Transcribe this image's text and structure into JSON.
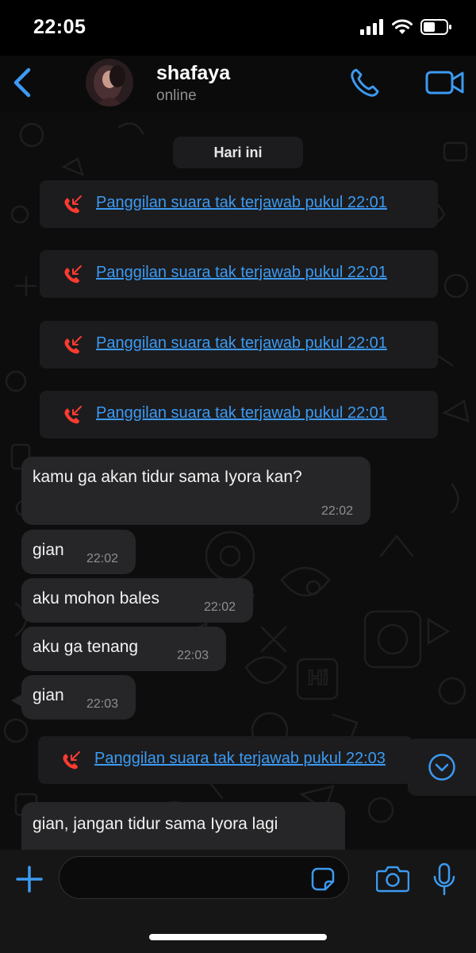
{
  "status_bar": {
    "time": "22:05"
  },
  "header": {
    "contact_name": "shafaya",
    "presence": "online"
  },
  "chat": {
    "date_label": "Hari ini",
    "missed_calls": [
      {
        "text": "Panggilan suara tak terjawab pukul 22:01"
      },
      {
        "text": "Panggilan suara tak terjawab pukul 22:01"
      },
      {
        "text": "Panggilan suara tak terjawab pukul 22:01"
      },
      {
        "text": "Panggilan suara tak terjawab pukul 22:01"
      }
    ],
    "messages": [
      {
        "text": "kamu ga akan tidur sama Iyora kan?",
        "time": "22:02"
      },
      {
        "text": "gian",
        "time": "22:02"
      },
      {
        "text": "aku mohon bales",
        "time": "22:02"
      },
      {
        "text": "aku ga tenang",
        "time": "22:03"
      },
      {
        "text": "gian",
        "time": "22:03"
      }
    ],
    "missed_call_later": {
      "text": "Panggilan suara tak terjawab pukul 22:03"
    },
    "last_message": {
      "text": "gian, jangan tidur sama Iyora lagi"
    }
  },
  "colors": {
    "accent": "#3c9af2",
    "missed_call_red": "#ff3b30",
    "bubble_bg": "#262628"
  },
  "icons": [
    "back-chevron-icon",
    "phone-icon",
    "video-camera-icon",
    "missed-call-icon",
    "chevron-down-icon",
    "plus-icon",
    "sticker-icon",
    "camera-icon",
    "microphone-icon"
  ]
}
